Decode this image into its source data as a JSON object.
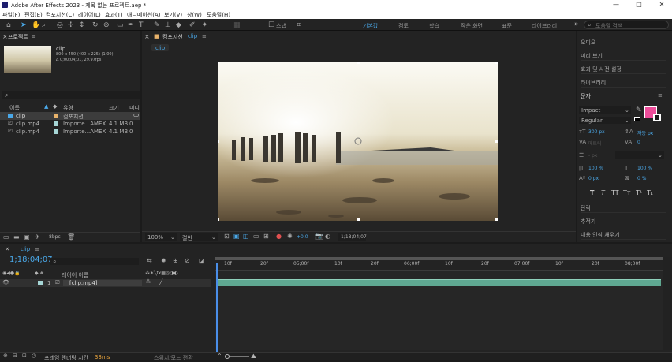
{
  "window": {
    "title": "Adobe After Effects 2023 - 제목 없는 프로젝트.aep *",
    "min": "—",
    "max": "□",
    "close": "✕"
  },
  "menus": [
    "파일(F)",
    "편집(E)",
    "컴포지션(C)",
    "레이어(L)",
    "효과(T)",
    "애니메이션(A)",
    "보기(V)",
    "창(W)",
    "도움말(H)"
  ],
  "workspaces": [
    "기본값",
    "검토",
    "학습",
    "작은 화면",
    "표준",
    "라이브러리"
  ],
  "workspace_more": "»",
  "search": {
    "placeholder": "도움말 검색"
  },
  "toolbar": {
    "snap_label": "스냅"
  },
  "project": {
    "title": "프로젝트",
    "item_name": "clip",
    "info1": "800 x 450  (400 x 225) (1.00)",
    "info2": "Δ 0;00;04;01, 29.97fps",
    "search_icon": "⌕",
    "columns": [
      "이름",
      "유형",
      "크기",
      "미디"
    ],
    "rows": [
      {
        "name": "clip",
        "type": "컴포지션",
        "size": "",
        "media": "",
        "color": "#e8b36b"
      },
      {
        "name": "clip.mp4",
        "type": "Importe...AMEX",
        "size": "4.1 MB",
        "media": "0",
        "color": "#a6d6d6"
      },
      {
        "name": "clip.mp4",
        "type": "Importe...AMEX",
        "size": "4.1 MB",
        "media": "0",
        "color": "#a6d6d6"
      }
    ],
    "bpc": "8bpc"
  },
  "comp": {
    "title": "컴포지션",
    "tab_name": "clip",
    "zoom": "100%",
    "resolution": "절반",
    "timecode": "1;18;04;07",
    "plus": "+0.0"
  },
  "right_panel": {
    "items_top": [
      "오디오",
      "미리 보기",
      "효과 및 사전 설정",
      "라이브러리"
    ],
    "character": {
      "title": "문자",
      "font": "Impact",
      "style": "Regular",
      "font_size": "300 px",
      "leading": "자동 px",
      "kerning": "메트릭",
      "tracking": "0",
      "stroke": "- px",
      "vscale": "100 %",
      "hscale": "100 %",
      "baseline": "0 px",
      "tsume": "0 %",
      "text_style_glyphs": [
        "T",
        "T",
        "TT",
        "Tт",
        "T¹",
        "T₁"
      ]
    },
    "items_bottom": [
      "단락",
      "추적기",
      "내용 인식 채우기"
    ],
    "fill_color": "#ec4d9a"
  },
  "timeline": {
    "tab": "clip",
    "timecode": "1;18;04;07",
    "col_header": "레이어 이름",
    "layer": {
      "num": "1",
      "name": "[clip.mp4]"
    },
    "ruler": [
      "10f",
      "20f",
      "05;00f",
      "10f",
      "20f",
      "06;00f",
      "10f",
      "20f",
      "07;00f",
      "10f",
      "20f",
      "08;00f"
    ],
    "render_label": "프레임 렌더링 시간",
    "render_value": "33ms",
    "toggle_label": "스위치/모드 전환"
  }
}
